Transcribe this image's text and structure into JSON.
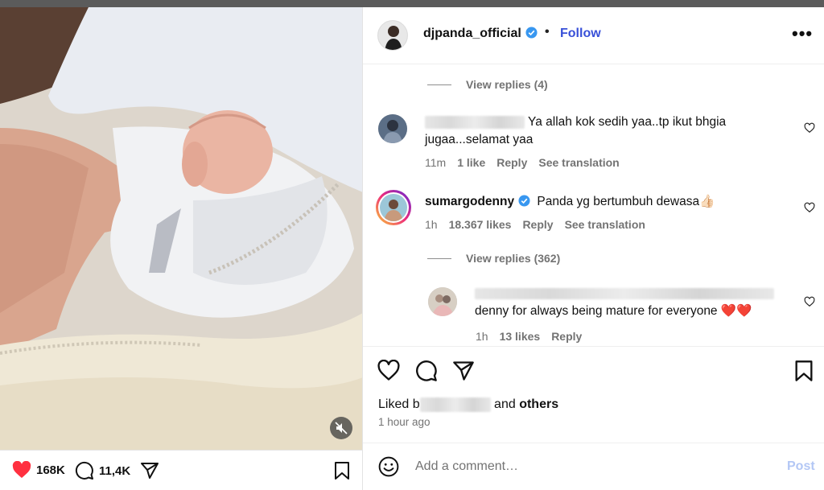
{
  "header": {
    "username": "djpanda_official",
    "separator": "•",
    "follow_label": "Follow",
    "more_label": "•••"
  },
  "media": {
    "likes_count": "168K",
    "comments_count": "11,4K"
  },
  "comments": {
    "view_replies_top": "View replies (4)",
    "c1": {
      "text": "Ya allah kok sedih yaa..tp ikut bhgia jugaa...selamat yaa",
      "text_line2": "jugaa...selamat yaa",
      "text_line1": "Ya allah kok sedih yaa..tp ikut bhgia",
      "time": "11m",
      "likes": "1 like",
      "reply": "Reply",
      "translate": "See translation"
    },
    "c2": {
      "username": "sumargodenny",
      "text": "Panda yg bertumbuh dewasa👍🏻",
      "time": "1h",
      "likes": "18.367 likes",
      "reply": "Reply",
      "translate": "See translation"
    },
    "view_replies_mid": "View replies (362)",
    "c3": {
      "text": "denny for always being mature for everyone ❤️❤️",
      "time": "1h",
      "likes": "13 likes",
      "reply": "Reply"
    }
  },
  "actions": {
    "liked_prefix": "Liked b",
    "liked_and": "and",
    "liked_others": "others",
    "time_ago": "1 hour ago"
  },
  "comment_bar": {
    "placeholder": "Add a comment…",
    "post_label": "Post"
  },
  "colors": {
    "follow": "#3850d8",
    "heart_liked": "#ff3040",
    "verified": "#3897f0",
    "post_disabled": "#b3c7f5"
  }
}
